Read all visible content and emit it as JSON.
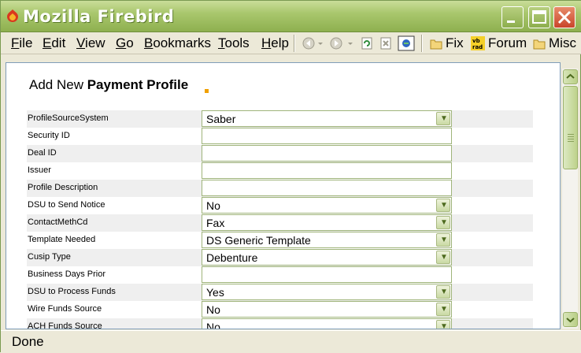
{
  "window": {
    "title": "Mozilla Firebird"
  },
  "menu": {
    "items": [
      {
        "key": "F",
        "rest": "ile"
      },
      {
        "key": "E",
        "rest": "dit"
      },
      {
        "key": "V",
        "rest": "iew"
      },
      {
        "key": "G",
        "rest": "o"
      },
      {
        "key": "B",
        "rest": "ookmarks"
      },
      {
        "key": "T",
        "rest": "ools"
      },
      {
        "key": "H",
        "rest": "elp"
      }
    ],
    "bookmarks": [
      "Fix",
      "Forum",
      "Misc"
    ]
  },
  "page": {
    "title_prefix": "Add New ",
    "title_bold": "Payment Profile",
    "rows": [
      {
        "label": "ProfileSourceSystem",
        "value": "Saber",
        "type": "select"
      },
      {
        "label": "Security ID",
        "value": "",
        "type": "text"
      },
      {
        "label": "Deal ID",
        "value": "",
        "type": "text"
      },
      {
        "label": "Issuer",
        "value": "",
        "type": "text"
      },
      {
        "label": "Profile Description",
        "value": "",
        "type": "text"
      },
      {
        "label": "DSU to Send Notice",
        "value": "No",
        "type": "select"
      },
      {
        "label": "ContactMethCd",
        "value": "Fax",
        "type": "select"
      },
      {
        "label": "Template Needed",
        "value": "DS Generic Template",
        "type": "select"
      },
      {
        "label": "Cusip Type",
        "value": "Debenture",
        "type": "select"
      },
      {
        "label": "Business Days Prior",
        "value": "",
        "type": "text"
      },
      {
        "label": "DSU to Process Funds",
        "value": "Yes",
        "type": "select"
      },
      {
        "label": "Wire Funds Source",
        "value": "No",
        "type": "select"
      },
      {
        "label": "ACH Funds Source",
        "value": "No",
        "type": "select"
      }
    ]
  },
  "status": {
    "text": "Done"
  }
}
